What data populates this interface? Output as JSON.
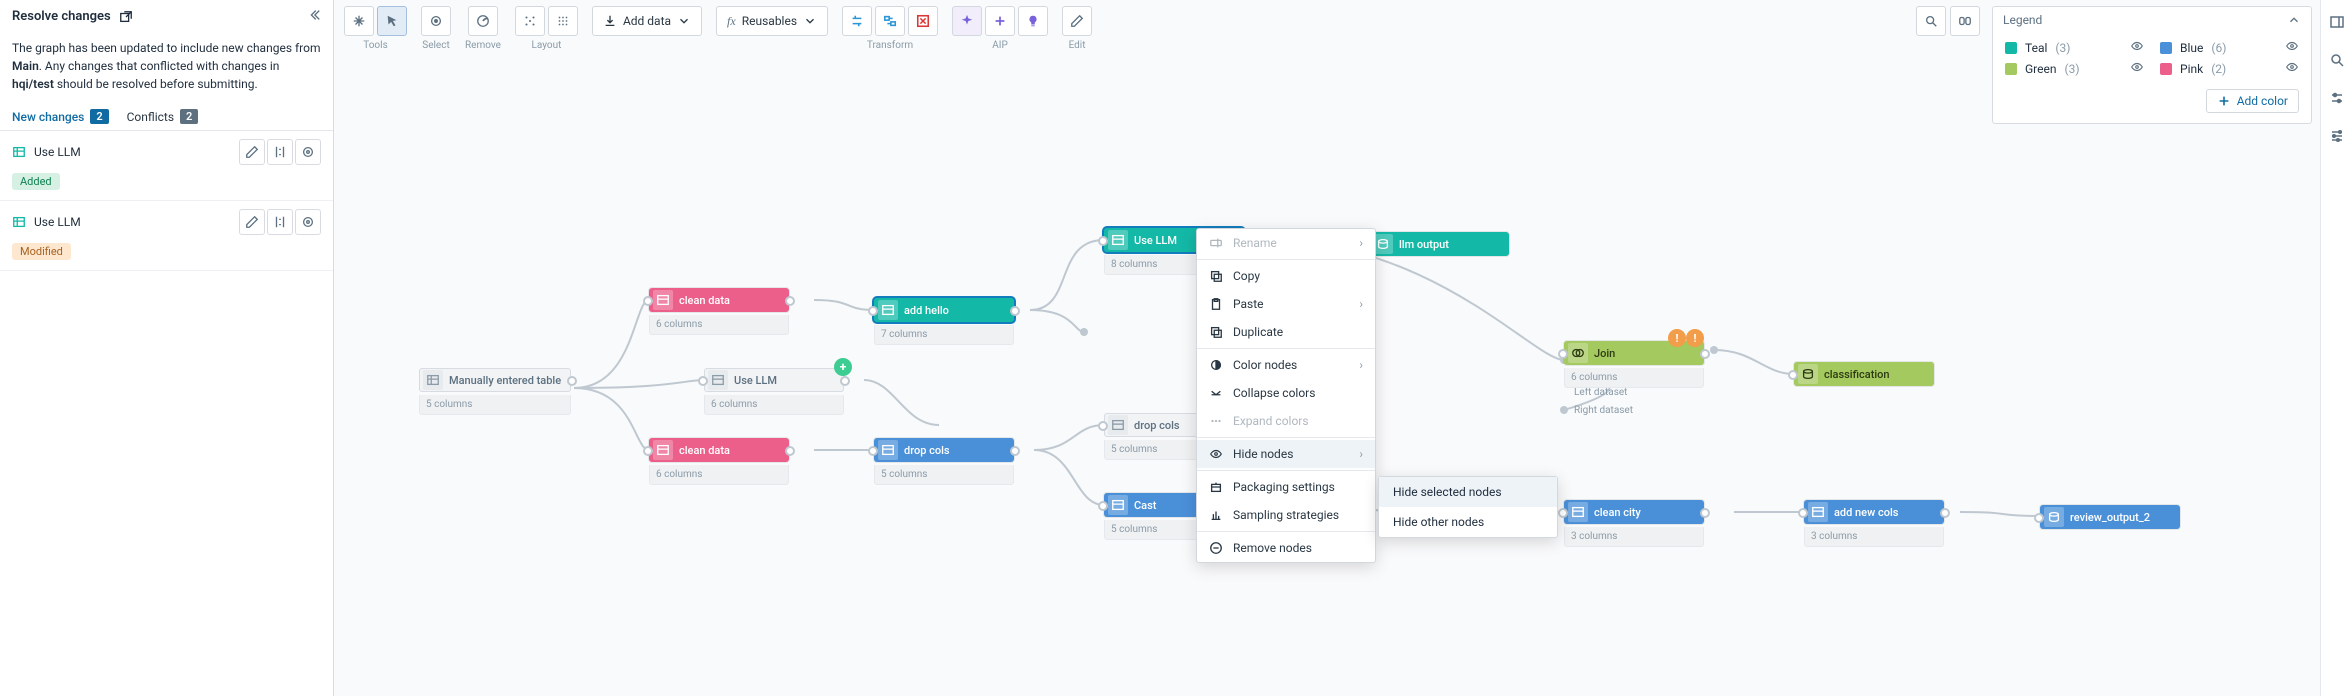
{
  "left": {
    "title": "Resolve changes",
    "description_parts": [
      "The graph has been updated to include new changes from ",
      "Main",
      ". Any changes that conflicted with changes in ",
      "hqi/test",
      " should be resolved before submitting."
    ],
    "tabs": {
      "new_changes": "New changes",
      "new_changes_count": "2",
      "conflicts": "Conflicts",
      "conflicts_count": "2"
    },
    "items": [
      {
        "name": "Use LLM",
        "status": "Added"
      },
      {
        "name": "Use LLM",
        "status": "Modified"
      }
    ]
  },
  "toolbar": {
    "groups": {
      "tools": "Tools",
      "select": "Select",
      "remove": "Remove",
      "layout": "Layout",
      "transform": "Transform",
      "aip": "AIP",
      "edit": "Edit"
    },
    "add_data": "Add data",
    "reusables": "Reusables"
  },
  "legend": {
    "title": "Legend",
    "items": [
      {
        "name": "Teal",
        "count": "(3)",
        "color": "#14b8a6"
      },
      {
        "name": "Blue",
        "count": "(6)",
        "color": "#4a90d9"
      },
      {
        "name": "Green",
        "count": "(3)",
        "color": "#a4c95e"
      },
      {
        "name": "Pink",
        "count": "(2)",
        "color": "#ec5f8a"
      }
    ],
    "add": "Add color"
  },
  "nodes": {
    "manual": {
      "label": "Manually entered table",
      "sub": "5 columns"
    },
    "clean1": {
      "label": "clean data",
      "sub": "6 columns"
    },
    "clean2": {
      "label": "clean data",
      "sub": "6 columns"
    },
    "usellm_ghost": {
      "label": "Use LLM",
      "sub": "6 columns"
    },
    "usellm_sel": {
      "label": "Use LLM",
      "sub": "8 columns"
    },
    "addhello": {
      "label": "add hello",
      "sub": "7 columns"
    },
    "dropcols_ghost": {
      "label": "drop cols",
      "sub": "5 columns"
    },
    "dropcols_blue": {
      "label": "drop cols",
      "sub": "5 columns"
    },
    "cast": {
      "label": "Cast",
      "sub": "5 columns"
    },
    "llmout": {
      "label": "llm output"
    },
    "join": {
      "label": "Join",
      "sub": "6 columns",
      "left": "Left dataset",
      "right": "Right dataset"
    },
    "classification": {
      "label": "classification"
    },
    "cleancity": {
      "label": "clean city",
      "sub": "3 columns"
    },
    "addnew": {
      "label": "add new cols",
      "sub": "3 columns"
    },
    "review": {
      "label": "review_output_2"
    }
  },
  "ctx": {
    "rename": "Rename",
    "copy": "Copy",
    "paste": "Paste",
    "duplicate": "Duplicate",
    "color": "Color nodes",
    "collapse": "Collapse colors",
    "expand": "Expand colors",
    "hide": "Hide nodes",
    "pkg": "Packaging settings",
    "sampling": "Sampling strategies",
    "remove": "Remove nodes",
    "sub_sel": "Hide selected nodes",
    "sub_other": "Hide other nodes"
  }
}
